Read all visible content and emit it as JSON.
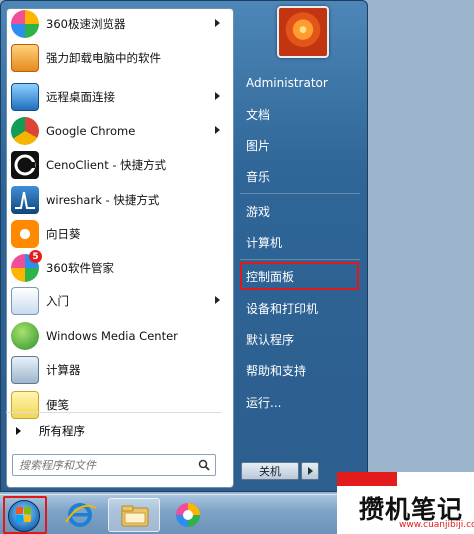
{
  "start_menu": {
    "programs": [
      {
        "label": "360极速浏览器",
        "icon": "360-browser-icon",
        "has_submenu": true
      },
      {
        "label": "强力卸载电脑中的软件",
        "icon": "uninstall-icon",
        "has_submenu": false
      },
      {
        "label": "远程桌面连接",
        "icon": "remote-desktop-icon",
        "has_submenu": true
      },
      {
        "label": "Google Chrome",
        "icon": "chrome-icon",
        "has_submenu": true
      },
      {
        "label": "CenoClient - 快捷方式",
        "icon": "cenoclient-icon",
        "has_submenu": false
      },
      {
        "label": "wireshark - 快捷方式",
        "icon": "wireshark-icon",
        "has_submenu": false
      },
      {
        "label": "向日葵",
        "icon": "sunflower-icon",
        "has_submenu": false
      },
      {
        "label": "360软件管家",
        "icon": "360-software-manager-icon",
        "has_submenu": false,
        "badge": "5"
      },
      {
        "label": "入门",
        "icon": "getting-started-icon",
        "has_submenu": true
      },
      {
        "label": "Windows Media Center",
        "icon": "media-center-icon",
        "has_submenu": false
      },
      {
        "label": "计算器",
        "icon": "calculator-icon",
        "has_submenu": false
      },
      {
        "label": "便笺",
        "icon": "sticky-notes-icon",
        "has_submenu": false
      }
    ],
    "all_programs": "所有程序",
    "search": {
      "placeholder": "搜索程序和文件"
    },
    "right_pane": {
      "user": "Administrator",
      "items": [
        "文档",
        "图片",
        "音乐",
        "游戏",
        "计算机",
        "控制面板",
        "设备和打印机",
        "默认程序",
        "帮助和支持",
        "运行..."
      ],
      "shutdown_label": "关机"
    }
  },
  "watermark": {
    "title": "攒机笔记",
    "url": "www.cuanjibiji.com"
  },
  "colors": {
    "highlight": "#e01818",
    "menu_blue": "#2f6597"
  }
}
